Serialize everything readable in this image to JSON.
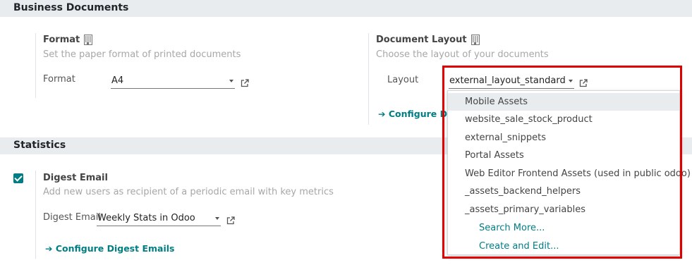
{
  "business_documents": {
    "section_title": "Business Documents",
    "format_setting": {
      "title": "Format",
      "description": "Set the paper format of printed documents",
      "field_label": "Format",
      "field_value": "A4"
    },
    "layout_setting": {
      "title": "Document Layout",
      "description": "Choose the layout of your documents",
      "field_label": "Layout",
      "field_value": "external_layout_standard",
      "configure_link": "Configure Docu"
    }
  },
  "statistics": {
    "section_title": "Statistics",
    "digest_setting": {
      "checked": true,
      "title": "Digest Email",
      "description": "Add new users as recipient of a periodic email with key metrics",
      "field_label": "Digest Email",
      "field_value": "Weekly Stats in Odoo",
      "configure_link": "Configure Digest Emails"
    }
  },
  "dropdown": {
    "items": [
      "Mobile Assets",
      "website_sale_stock_product",
      "external_snippets",
      "Portal Assets",
      "Web Editor Frontend Assets (used in public odoo)",
      "_assets_backend_helpers",
      "_assets_primary_variables"
    ],
    "search_more": "Search More...",
    "create_edit": "Create and Edit..."
  },
  "icons": {
    "building": "building-icon",
    "external": "external-link-icon",
    "arrow": "arrow-right-icon",
    "caret": "caret-down-icon",
    "check": "checkbox-check-icon"
  },
  "colors": {
    "accent": "#017e84",
    "highlight": "#e00000",
    "section_bg": "#e9ecef"
  }
}
